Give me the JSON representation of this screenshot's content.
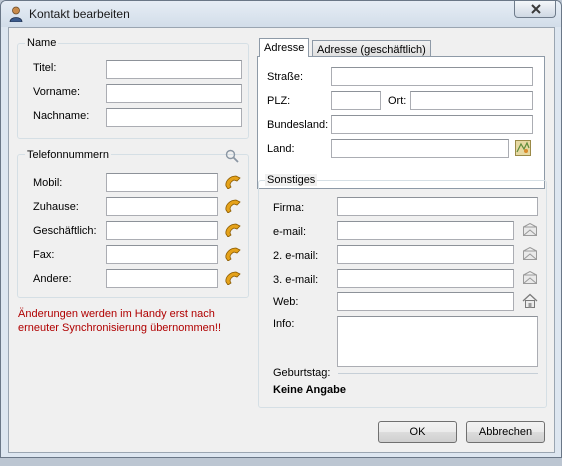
{
  "window": {
    "title": "Kontakt bearbeiten",
    "icon": "contact-person-icon"
  },
  "name_group": {
    "title": "Name",
    "fields": [
      {
        "label": "Titel:",
        "value": ""
      },
      {
        "label": "Vorname:",
        "value": ""
      },
      {
        "label": "Nachname:",
        "value": ""
      }
    ]
  },
  "phone_group": {
    "title": "Telefonnummern",
    "fields": [
      {
        "label": "Mobil:",
        "value": ""
      },
      {
        "label": "Zuhause:",
        "value": ""
      },
      {
        "label": "Geschäftlich:",
        "value": ""
      },
      {
        "label": "Fax:",
        "value": ""
      },
      {
        "label": "Andere:",
        "value": ""
      }
    ]
  },
  "warning": "Änderungen werden im Handy erst nach erneuter Synchronisierung übernommen!!",
  "address_tabs": {
    "tabs": [
      "Adresse",
      "Adresse (geschäftlich)"
    ],
    "active": 0,
    "street_label": "Straße:",
    "plz_label": "PLZ:",
    "city_label": "Ort:",
    "state_label": "Bundesland:",
    "country_label": "Land:",
    "street": "",
    "plz": "",
    "city": "",
    "state": "",
    "country": ""
  },
  "other_group": {
    "title": "Sonstiges",
    "company_label": "Firma:",
    "email1_label": "e-mail:",
    "email2_label": "2. e-mail:",
    "email3_label": "3. e-mail:",
    "web_label": "Web:",
    "info_label": "Info:",
    "birthday_label": "Geburtstag:",
    "birthday_value": "Keine Angabe",
    "company": "",
    "email1": "",
    "email2": "",
    "email3": "",
    "web": "",
    "info": ""
  },
  "buttons": {
    "ok": "OK",
    "cancel": "Abbrechen"
  },
  "colors": {
    "warning": "#b00000",
    "window_frame": "#dde6f0",
    "dialog": "#f0f0f0"
  }
}
